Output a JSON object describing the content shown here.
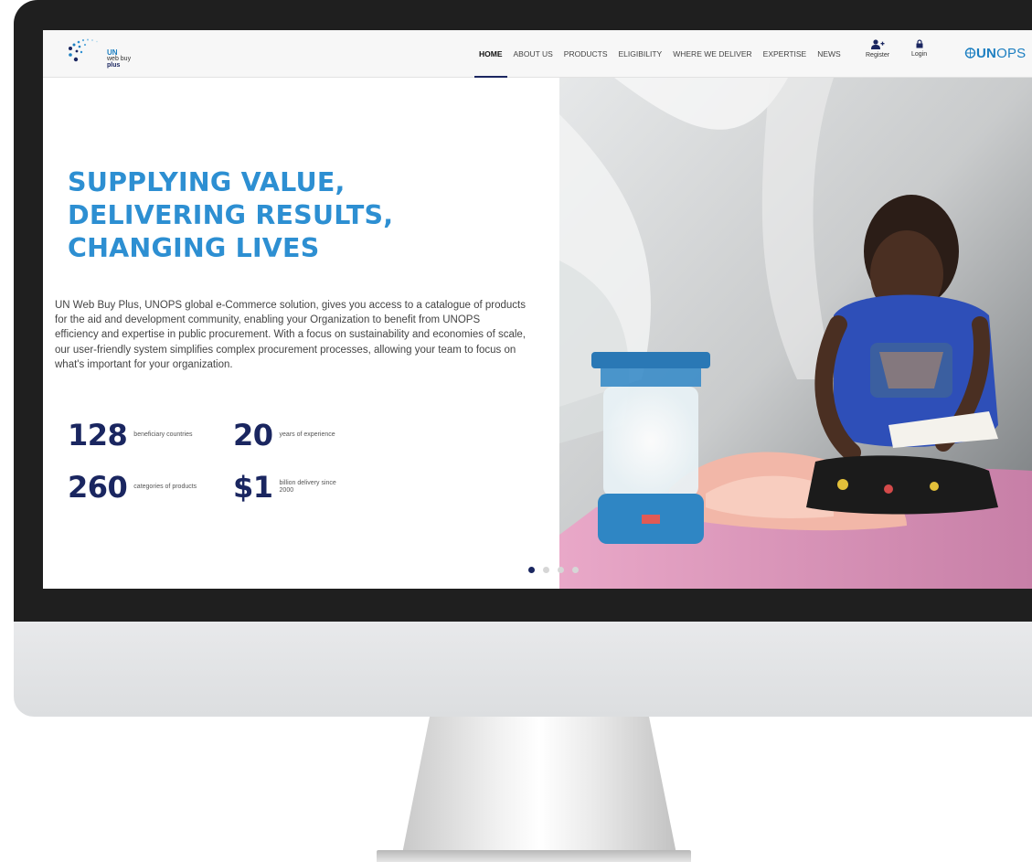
{
  "header": {
    "logo": {
      "un": "UN",
      "webbuy": "web buy",
      "plus": "plus"
    },
    "nav": [
      "HOME",
      "ABOUT US",
      "PRODUCTS",
      "ELIGIBILITY",
      "WHERE WE DELIVER",
      "EXPERTISE",
      "NEWS"
    ],
    "register_label": "Register",
    "login_label": "Login",
    "brand": {
      "prefix": "UN",
      "suffix": "OPS"
    }
  },
  "hero": {
    "headline": [
      "SUPPLYING VALUE,",
      "DELIVERING RESULTS,",
      "CHANGING LIVES"
    ],
    "description": "UN Web Buy Plus, UNOPS global e-Commerce solution, gives you access to a catalogue of products for the aid and development community, enabling your Organization to benefit from UNOPS efficiency and expertise in public procurement. With a focus on sustainability and economies of scale, our user-friendly system simplifies complex procurement processes, allowing your team to focus on what's important for your organization.",
    "stats": [
      {
        "value": "128",
        "label": "beneficiary countries"
      },
      {
        "value": "20",
        "label": "years of experience"
      },
      {
        "value": "260",
        "label": "categories of products"
      },
      {
        "value": "$1",
        "label": "billion delivery since 2000"
      }
    ],
    "carousel": {
      "slide_count": 4,
      "active": 0
    }
  },
  "colors": {
    "headline": "#2d8fd2",
    "navy": "#1a2660",
    "brand": "#1d7fc1"
  },
  "icons": [
    "logo-dots-icon",
    "user-plus-icon",
    "lock-icon",
    "un-emblem-icon"
  ]
}
